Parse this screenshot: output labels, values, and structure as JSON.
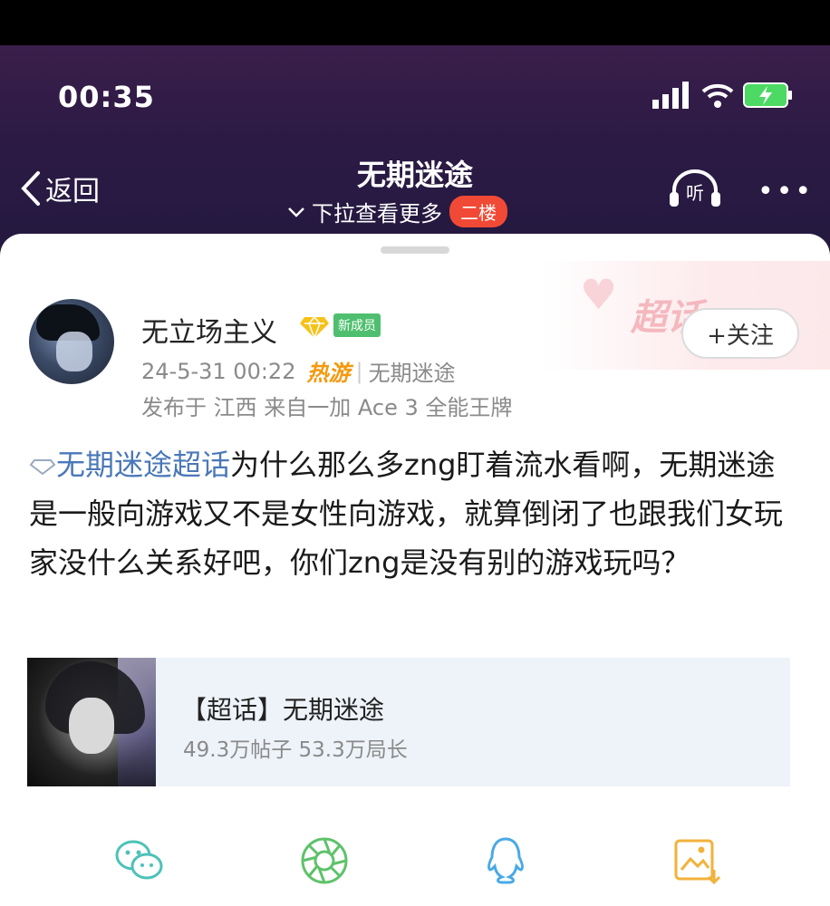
{
  "status_bar": {
    "time": "00:35"
  },
  "nav": {
    "back_label": "返回",
    "title": "无期迷途",
    "subtitle": "下拉查看更多",
    "badge": "二楼",
    "listen_label": "听",
    "more_label": "•••"
  },
  "post": {
    "author": "无立场主义",
    "member_badge": "新成员",
    "follow_label": "+关注",
    "date": "24-5-31 00:22",
    "hot_game": "热游",
    "game_name": "无期迷途",
    "location_line": "发布于 江西  来自一加 Ace 3 全能王牌",
    "topic_tag": "无期迷途超话",
    "body": "为什么那么多zng盯着流水看啊，无期迷途是一般向游戏又不是女性向游戏，就算倒闭了也跟我们女玩家没什么关系好吧，你们zng是没有别的游戏玩吗？",
    "deco_label": "超话"
  },
  "topic_card": {
    "title": "【超话】无期迷途",
    "stats": "49.3万帖子 53.3万局长"
  },
  "share_bar": {
    "items": [
      "wechat-icon",
      "moments-icon",
      "qq-icon",
      "save-image-icon"
    ]
  },
  "colors": {
    "header_bg": "#2c1a45",
    "topic_link": "#4a78b8",
    "badge_red": "#f04a36",
    "hot_orange": "#f39a10",
    "member_green": "#4fbf6f"
  }
}
